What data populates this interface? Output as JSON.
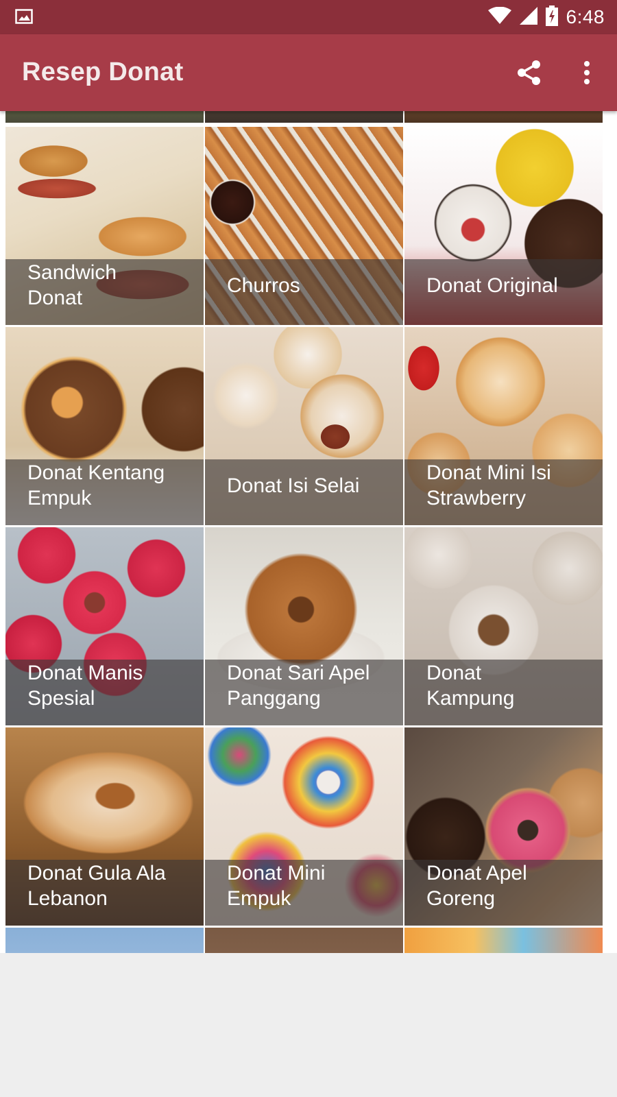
{
  "status_bar": {
    "time": "6:48",
    "icons": [
      "image-icon",
      "wifi-icon",
      "signal-icon",
      "battery-charging-icon"
    ]
  },
  "app_bar": {
    "title": "Resep Donat",
    "actions": [
      "share-icon",
      "more-vert-icon"
    ]
  },
  "colors": {
    "status_bar": "#8b2f3a",
    "app_bar": "#a73c48",
    "caption_overlay": "rgba(60,55,55,0.62)",
    "background": "#eeeeee"
  },
  "recipes": [
    {
      "title": "Sandwich Donat",
      "line1": "Sandwich",
      "line2": "Donat"
    },
    {
      "title": "Churros",
      "line1": "Churros",
      "line2": ""
    },
    {
      "title": "Donat Original",
      "line1": "Donat Original",
      "line2": ""
    },
    {
      "title": "Donat Kentang Empuk",
      "line1": "Donat Kentang",
      "line2": "Empuk"
    },
    {
      "title": "Donat Isi Selai",
      "line1": "Donat Isi Selai",
      "line2": ""
    },
    {
      "title": "Donat Mini Isi Strawberry",
      "line1": "Donat Mini Isi",
      "line2": "Strawberry"
    },
    {
      "title": "Donat Manis Spesial",
      "line1": "Donat Manis",
      "line2": "Spesial"
    },
    {
      "title": "Donat Sari Apel Panggang",
      "line1": "Donat Sari Apel",
      "line2": "Panggang"
    },
    {
      "title": "Donat Kampung",
      "line1": "Donat",
      "line2": "Kampung"
    },
    {
      "title": "Donat Gula Ala Lebanon",
      "line1": "Donat Gula Ala",
      "line2": "Lebanon"
    },
    {
      "title": "Donat Mini Empuk",
      "line1": "Donat Mini",
      "line2": "Empuk"
    },
    {
      "title": "Donat Apel Goreng",
      "line1": "Donat Apel",
      "line2": "Goreng"
    }
  ]
}
